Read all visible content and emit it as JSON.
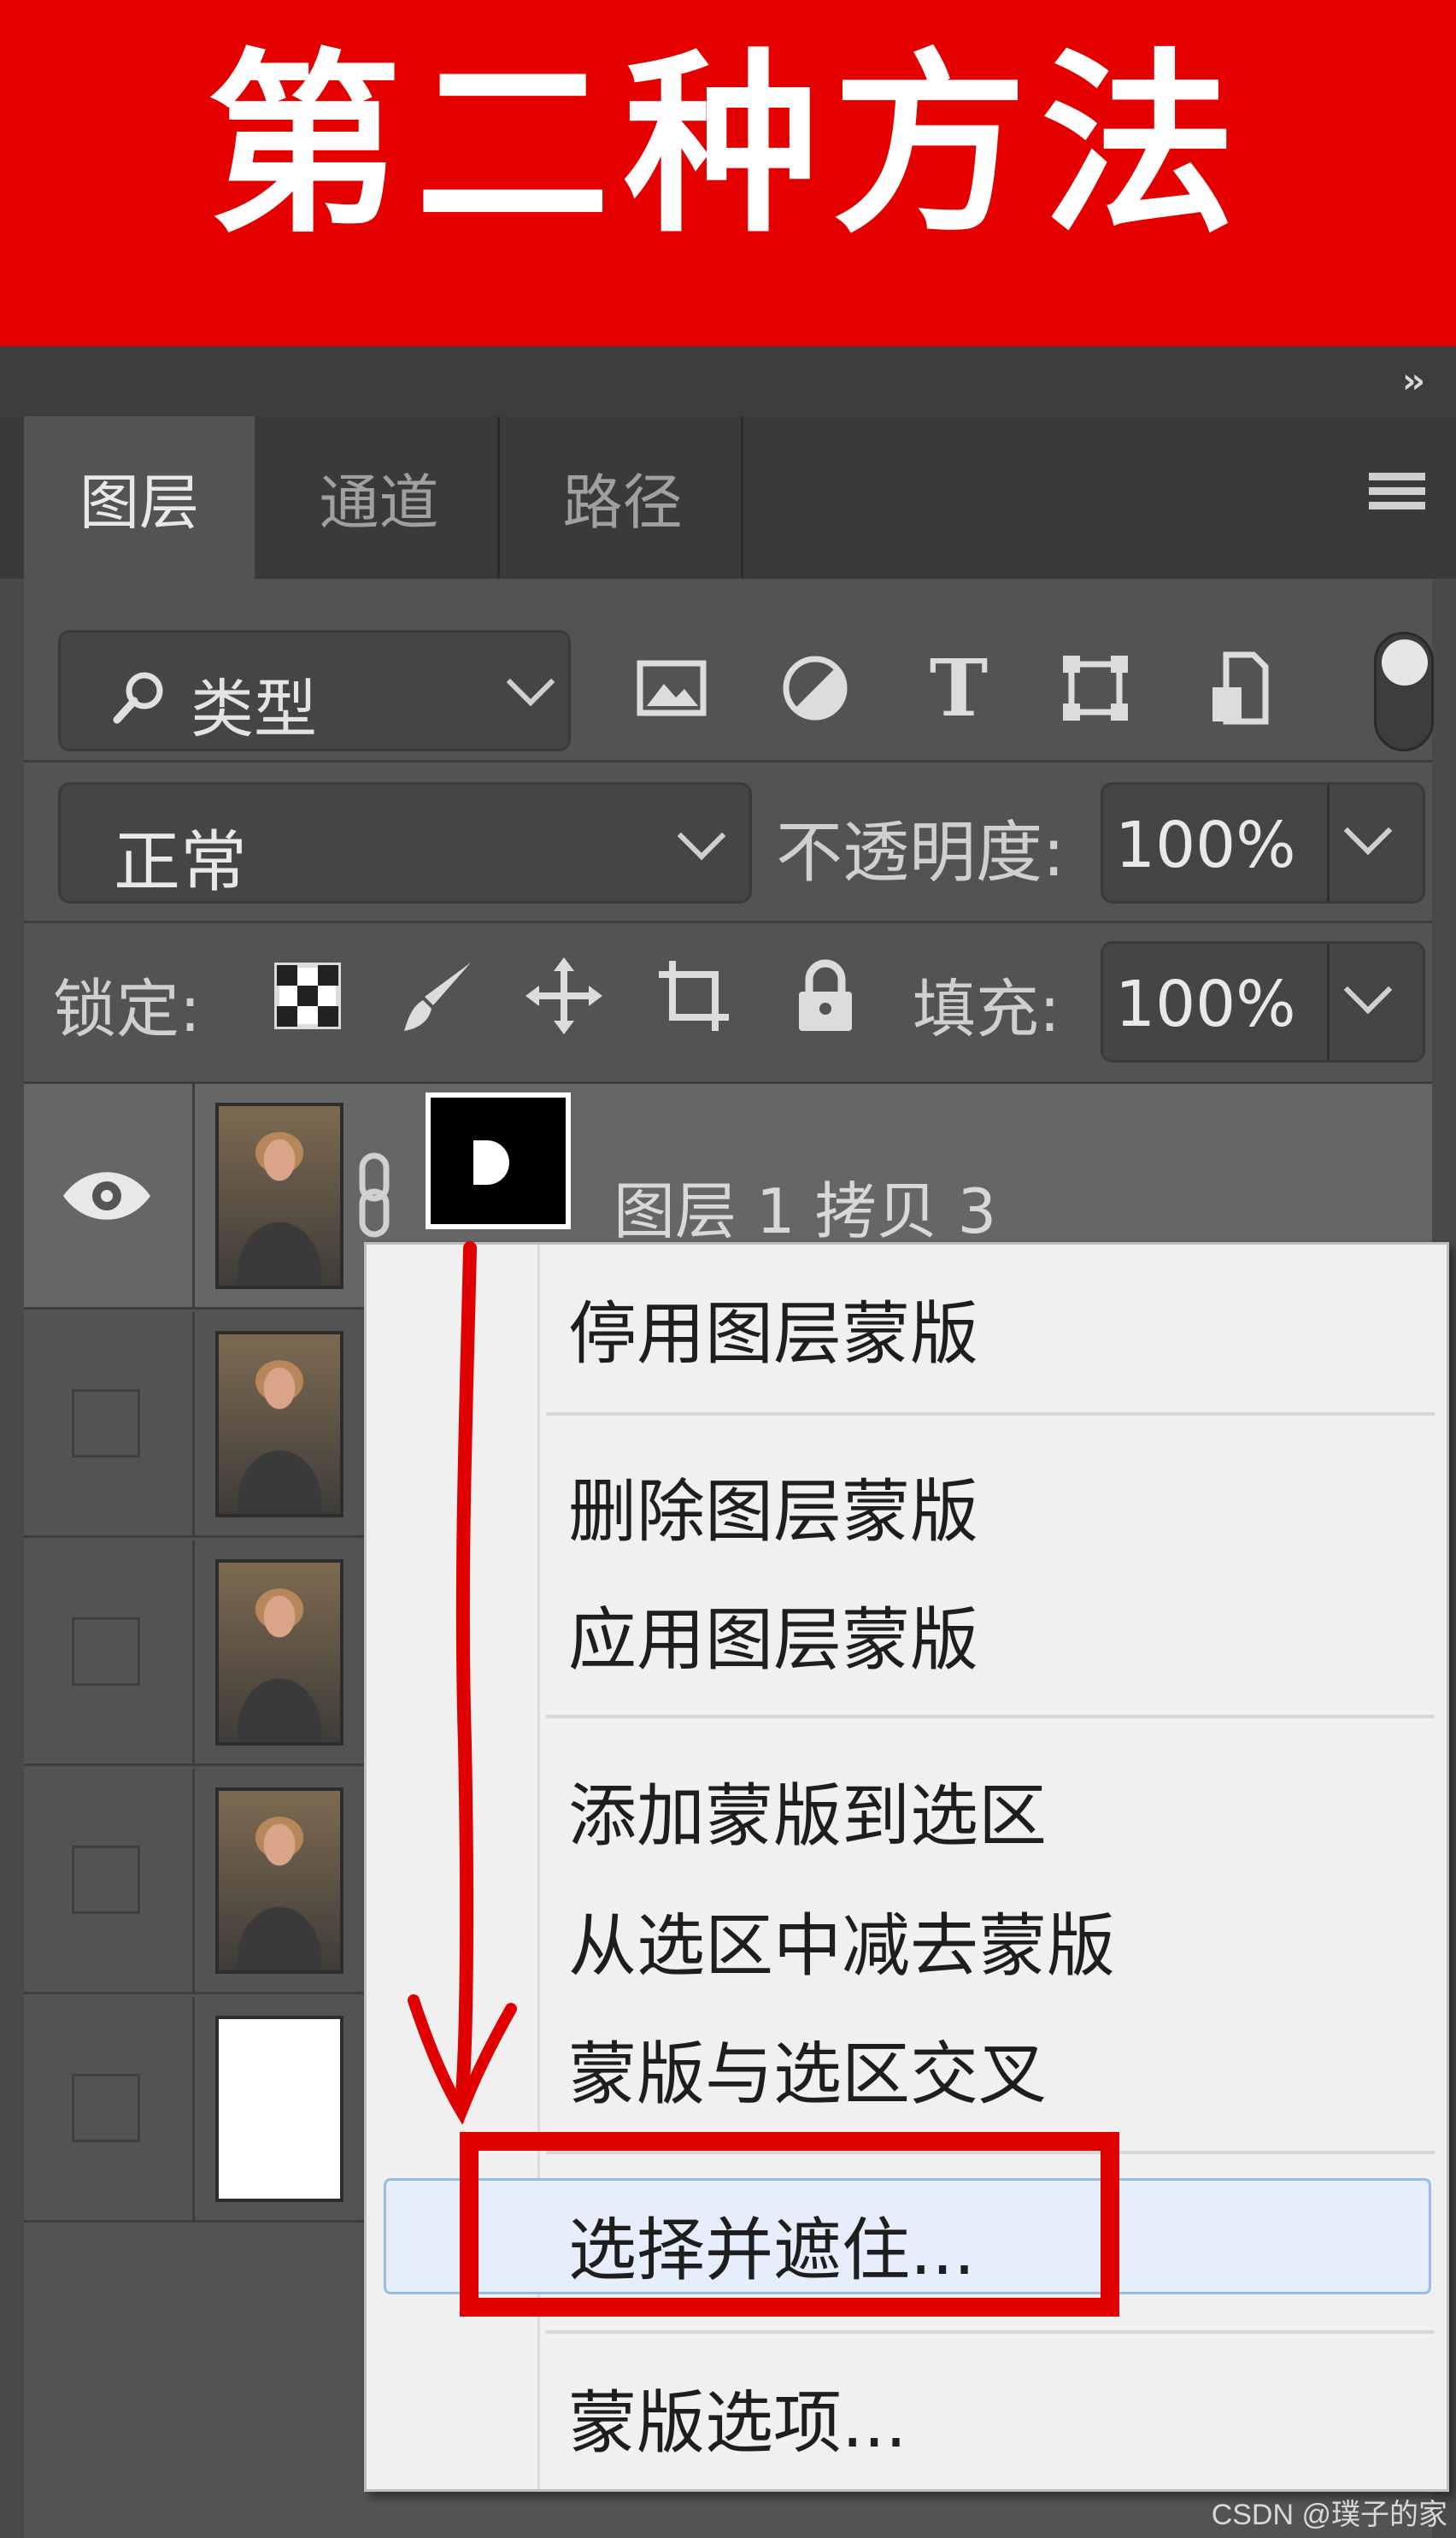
{
  "banner": {
    "title": "第二种方法",
    "background": "#e50000"
  },
  "tabs": [
    {
      "label": "图层",
      "active": true
    },
    {
      "label": "通道",
      "active": false
    },
    {
      "label": "路径",
      "active": false
    }
  ],
  "filter": {
    "kind_label": "类型",
    "icons": [
      "image-filter-icon",
      "adjustment-filter-icon",
      "type-filter-icon",
      "shape-filter-icon",
      "smart-object-filter-icon"
    ],
    "type_glyph": "T"
  },
  "blend": {
    "mode": "正常",
    "opacity_label": "不透明度:",
    "opacity_value": "100%"
  },
  "lock": {
    "label": "锁定:",
    "fill_label": "填充:",
    "fill_value": "100%"
  },
  "layers": [
    {
      "name": "图层 1 拷贝 3",
      "visible": true,
      "selected": true,
      "has_mask": true
    },
    {
      "name": "",
      "visible": false
    },
    {
      "name": "",
      "visible": false
    },
    {
      "name": "",
      "visible": false
    },
    {
      "name": "",
      "visible": false
    }
  ],
  "context_menu": {
    "items": [
      {
        "label": "停用图层蒙版"
      },
      {
        "label": "删除图层蒙版"
      },
      {
        "label": "应用图层蒙版"
      },
      {
        "label": "添加蒙版到选区"
      },
      {
        "label": "从选区中减去蒙版"
      },
      {
        "label": "蒙版与选区交叉"
      },
      {
        "label": "选择并遮住...",
        "highlighted": true
      },
      {
        "label": "蒙版选项..."
      }
    ]
  },
  "annotation_color": "#e00000",
  "watermark": "CSDN @璞子的家"
}
